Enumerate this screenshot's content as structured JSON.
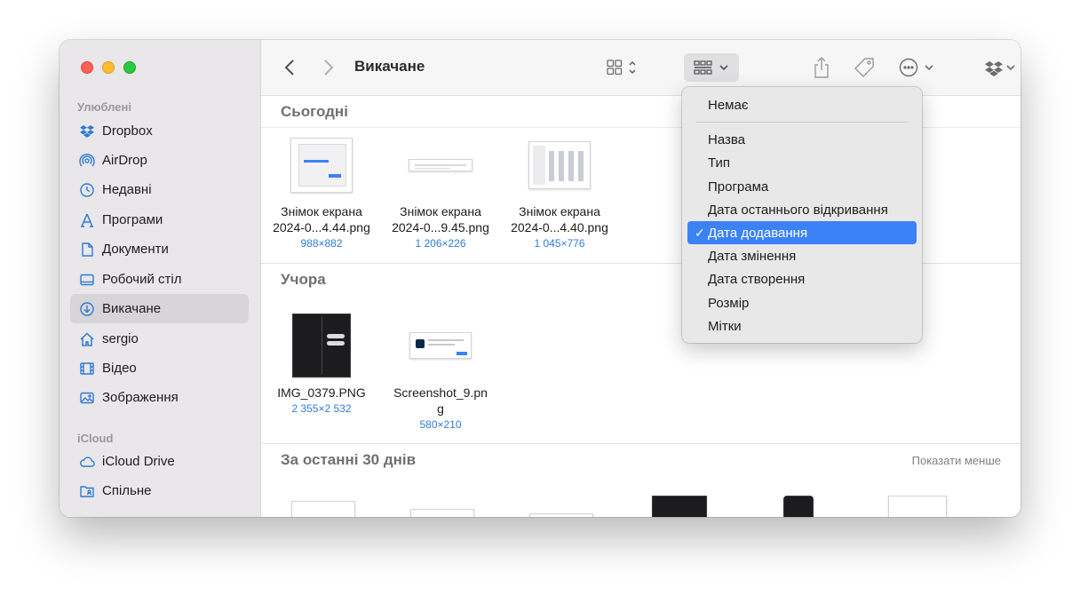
{
  "window": {
    "title": "Викачане"
  },
  "sidebar": {
    "favorites_heading": "Улюблені",
    "icloud_heading": "iCloud",
    "favorites": [
      {
        "label": "Dropbox",
        "icon": "dropbox-icon"
      },
      {
        "label": "AirDrop",
        "icon": "airdrop-icon"
      },
      {
        "label": "Недавні",
        "icon": "clock-icon"
      },
      {
        "label": "Програми",
        "icon": "applications-icon"
      },
      {
        "label": "Документи",
        "icon": "document-icon"
      },
      {
        "label": "Робочий стіл",
        "icon": "desktop-icon"
      },
      {
        "label": "Викачане",
        "icon": "download-icon",
        "selected": true
      },
      {
        "label": "sergio",
        "icon": "home-icon"
      },
      {
        "label": "Відео",
        "icon": "film-icon"
      },
      {
        "label": "Зображення",
        "icon": "photo-icon"
      }
    ],
    "icloud": [
      {
        "label": "iCloud Drive",
        "icon": "cloud-icon"
      },
      {
        "label": "Спільне",
        "icon": "shared-folder-icon"
      }
    ]
  },
  "sections": {
    "today": {
      "title": "Сьогодні",
      "files": [
        {
          "name1": "Знімок екрана",
          "name2": "2024-0...4.44.png",
          "dims": "988×882"
        },
        {
          "name1": "Знімок екрана",
          "name2": "2024-0...9.45.png",
          "dims": "1 206×226"
        },
        {
          "name1": "Знімок екрана",
          "name2": "2024-0...4.40.png",
          "dims": "1 045×776"
        }
      ]
    },
    "yesterday": {
      "title": "Учора",
      "files": [
        {
          "name1": "IMG_0379.PNG",
          "name2": "",
          "dims": "2 355×2 532"
        },
        {
          "name1": "Screenshot_9.pn",
          "name2": "g",
          "dims": "580×210"
        }
      ]
    },
    "last30": {
      "title": "За останні 30 днів",
      "show_less": "Показати менше"
    }
  },
  "group_menu": {
    "items": [
      {
        "label": "Немає"
      },
      {
        "label": "Назва"
      },
      {
        "label": "Тип"
      },
      {
        "label": "Програма"
      },
      {
        "label": "Дата останнього відкривання"
      },
      {
        "label": "Дата додавання",
        "selected": true
      },
      {
        "label": "Дата змінення"
      },
      {
        "label": "Дата створення"
      },
      {
        "label": "Розмір"
      },
      {
        "label": "Мітки"
      }
    ],
    "check": "✓"
  },
  "colors": {
    "accent": "#3a82f6",
    "sidebar_icon": "#2f7bd6",
    "sidebar_bg": "#e9e7e9"
  }
}
